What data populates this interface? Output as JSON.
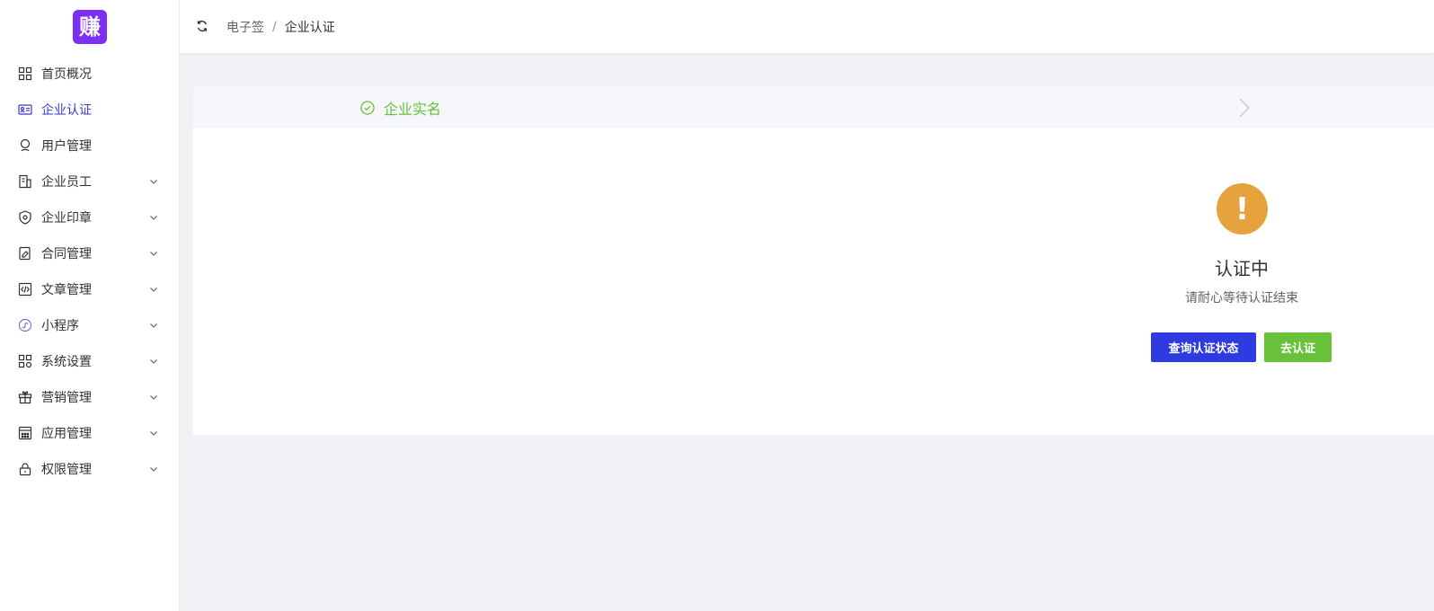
{
  "logo": {
    "text": "赚",
    "color": "#7b2ff2"
  },
  "sidebar": {
    "items": [
      {
        "label": "首页概况",
        "icon": "dashboard-icon",
        "expandable": false,
        "active": false
      },
      {
        "label": "企业认证",
        "icon": "id-card-icon",
        "expandable": false,
        "active": true
      },
      {
        "label": "用户管理",
        "icon": "user-icon",
        "expandable": false,
        "active": false
      },
      {
        "label": "企业员工",
        "icon": "office-building-icon",
        "expandable": true,
        "active": false
      },
      {
        "label": "企业印章",
        "icon": "shield-seal-icon",
        "expandable": true,
        "active": false
      },
      {
        "label": "合同管理",
        "icon": "contract-icon",
        "expandable": true,
        "active": false
      },
      {
        "label": "文章管理",
        "icon": "code-doc-icon",
        "expandable": true,
        "active": false
      },
      {
        "label": "小程序",
        "icon": "miniprogram-icon",
        "expandable": true,
        "active": false
      },
      {
        "label": "系统设置",
        "icon": "settings-grid-icon",
        "expandable": true,
        "active": false
      },
      {
        "label": "营销管理",
        "icon": "gift-icon",
        "expandable": true,
        "active": false
      },
      {
        "label": "应用管理",
        "icon": "app-grid-icon",
        "expandable": true,
        "active": false
      },
      {
        "label": "权限管理",
        "icon": "lock-icon",
        "expandable": true,
        "active": false
      }
    ]
  },
  "topbar": {
    "refresh_icon": "refresh-icon",
    "breadcrumb": {
      "parent": "电子签",
      "separator": "/",
      "current": "企业认证"
    }
  },
  "steps": {
    "items": [
      {
        "label": "企业实名",
        "status": "success",
        "icon": "check-circle-icon"
      }
    ]
  },
  "result": {
    "icon": "warning-icon",
    "icon_glyph": "!",
    "title": "认证中",
    "subtitle": "请耐心等待认证结束",
    "query_button": "查询认证状态",
    "go_button": "去认证"
  },
  "colors": {
    "primary": "#2d3be0",
    "success": "#67c23a",
    "warning": "#e6a23c",
    "active_menu": "#3a3acb"
  }
}
